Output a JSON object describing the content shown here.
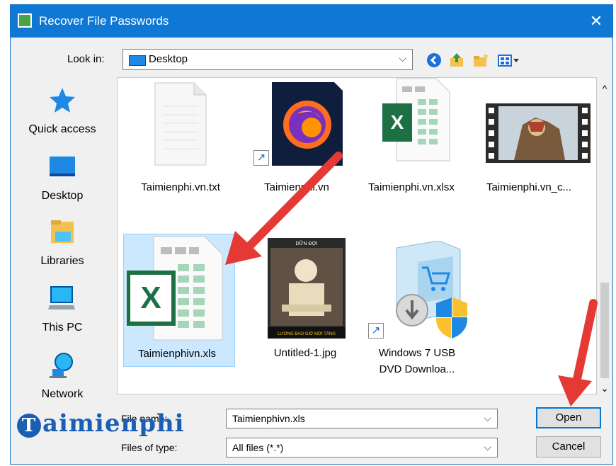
{
  "window": {
    "title": "Recover File Passwords",
    "close_glyph": "✕"
  },
  "toolbar": {
    "look_in_label": "Look in:",
    "look_in_value": "Desktop",
    "dropdown_glyph": "⌵",
    "back_icon": "back-icon",
    "up_icon": "up-folder-icon",
    "newfolder_icon": "new-folder-icon",
    "views_icon": "view-menu-icon"
  },
  "places": [
    {
      "label": "Quick access",
      "icon": "star-icon"
    },
    {
      "label": "Desktop",
      "icon": "desktop-icon"
    },
    {
      "label": "Libraries",
      "icon": "libraries-icon"
    },
    {
      "label": "This PC",
      "icon": "computer-icon"
    },
    {
      "label": "Network",
      "icon": "network-icon"
    }
  ],
  "files": [
    {
      "name": "Taimienphi.vn.txt",
      "kind": "text"
    },
    {
      "name": "Taimienphi.vn",
      "kind": "firefox-shortcut"
    },
    {
      "name": "Taimienphi.vn.xlsx",
      "kind": "excel"
    },
    {
      "name": "Taimienphi.vn_c...",
      "kind": "video"
    },
    {
      "name": "Taimienphivn.xls",
      "kind": "excel",
      "selected": true
    },
    {
      "name": "Untitled-1.jpg",
      "kind": "image"
    },
    {
      "name_line1": "Windows 7 USB",
      "name_line2": "DVD Downloa...",
      "kind": "installer-shortcut"
    }
  ],
  "thumbnail_texts": {
    "image_top": "DỮN ĐỢI",
    "image_bottom": "LƯƠNG BAO GIỜ MỚI TĂNG"
  },
  "scrollbar": {
    "up_glyph": "^",
    "down_glyph": "⌄"
  },
  "footer": {
    "filename_label": "File name:",
    "filename_value": "Taimienphivn.xls",
    "filetype_label": "Files of type:",
    "filetype_value": "All files (*.*)",
    "open_label": "Open",
    "cancel_label": "Cancel"
  },
  "watermark": {
    "initial": "T",
    "rest": "aimienphi"
  },
  "colors": {
    "title_bar": "#0f78d4",
    "selection": "#cce8ff",
    "annotation_arrow": "#e53935",
    "excel_green": "#1d7044"
  }
}
